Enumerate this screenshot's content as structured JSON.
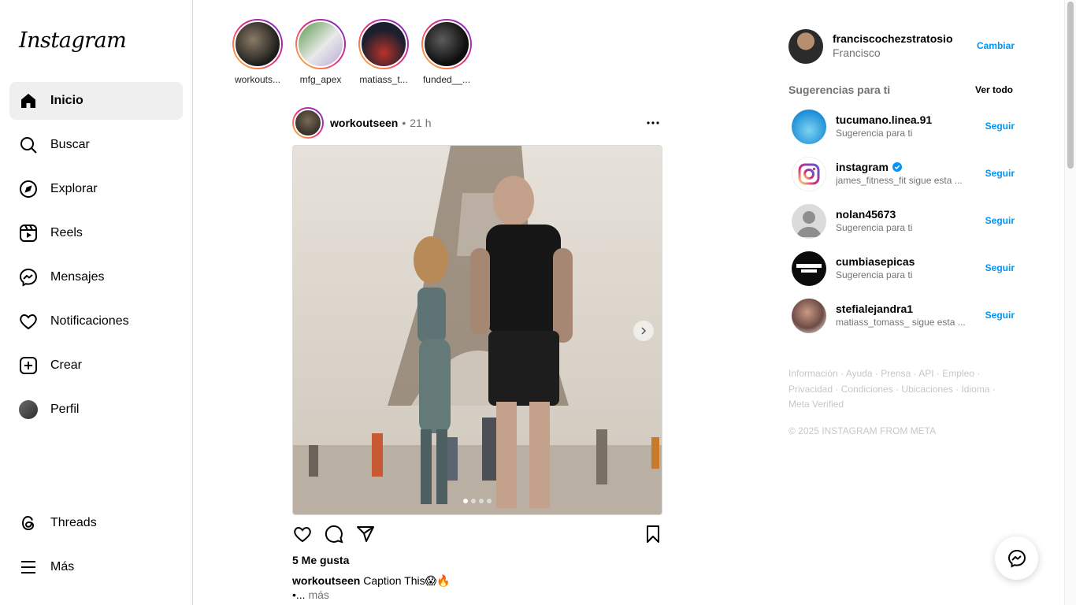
{
  "logo": "Instagram",
  "nav": {
    "items": [
      {
        "label": "Inicio",
        "icon": "home-icon"
      },
      {
        "label": "Buscar",
        "icon": "search-icon"
      },
      {
        "label": "Explorar",
        "icon": "compass-icon"
      },
      {
        "label": "Reels",
        "icon": "reels-icon"
      },
      {
        "label": "Mensajes",
        "icon": "messenger-icon"
      },
      {
        "label": "Notificaciones",
        "icon": "heart-icon"
      },
      {
        "label": "Crear",
        "icon": "plus-square-icon"
      },
      {
        "label": "Perfil",
        "icon": "avatar"
      }
    ],
    "bottom": [
      {
        "label": "Threads",
        "icon": "threads-icon"
      },
      {
        "label": "Más",
        "icon": "menu-icon"
      }
    ]
  },
  "stories": [
    {
      "name": "workouts..."
    },
    {
      "name": "mfg_apex"
    },
    {
      "name": "matiass_t..."
    },
    {
      "name": "funded__..."
    }
  ],
  "post": {
    "username": "workoutseen",
    "separator": "•",
    "time": "21 h",
    "likes": "5 Me gusta",
    "caption_user": "workoutseen",
    "caption_text": "Caption This😱🔥",
    "more_prefix": "•...",
    "more_label": "más",
    "carousel_position": 1,
    "carousel_total": 4
  },
  "me": {
    "username": "franciscochezstratosio",
    "name": "Francisco",
    "switch_label": "Cambiar"
  },
  "suggestions": {
    "title": "Sugerencias para ti",
    "see_all": "Ver todo",
    "follow_label": "Seguir",
    "items": [
      {
        "username": "tucumano.linea.91",
        "sub": "Sugerencia para ti",
        "verified": false
      },
      {
        "username": "instagram",
        "sub": "james_fitness_fit sigue esta ...",
        "verified": true
      },
      {
        "username": "nolan45673",
        "sub": "Sugerencia para ti",
        "verified": false
      },
      {
        "username": "cumbiasepicas",
        "sub": "Sugerencia para ti",
        "verified": false
      },
      {
        "username": "stefialejandra1",
        "sub": "matiass_tomass_ sigue esta ...",
        "verified": false
      }
    ]
  },
  "footer": {
    "links": [
      "Información",
      "Ayuda",
      "Prensa",
      "API",
      "Empleo",
      "Privacidad",
      "Condiciones",
      "Ubicaciones",
      "Idioma",
      "Meta Verified"
    ],
    "copyright": "© 2025 INSTAGRAM FROM META"
  },
  "colors": {
    "accent": "#0095f6",
    "muted": "#737373",
    "story_ring": "#ee2a7b"
  }
}
